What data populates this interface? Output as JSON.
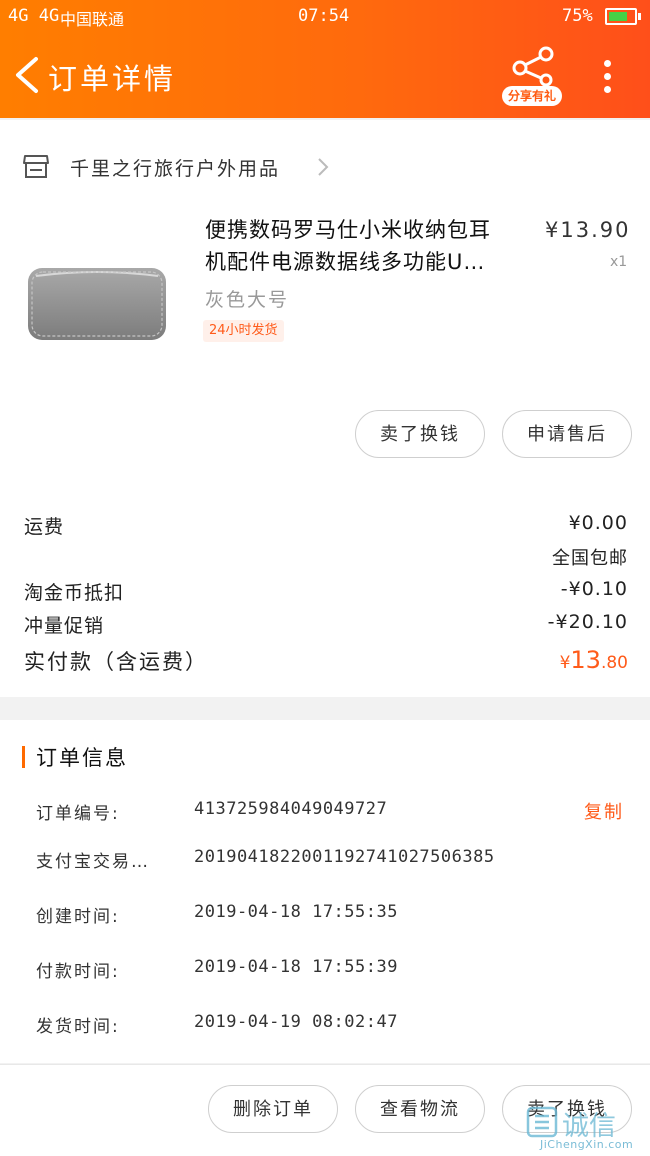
{
  "status_bar": {
    "signal": "4G 4G",
    "carrier": "中国联通",
    "time": "07:54",
    "battery": "75%"
  },
  "header": {
    "title": "订单详情",
    "share_badge": "分享有礼",
    "icons": [
      "chevron-left-icon",
      "share-icon",
      "more-vertical-icon"
    ]
  },
  "shop": {
    "name": "千里之行旅行户外用品",
    "icon": "store-icon"
  },
  "product": {
    "title_line1": "便携数码罗马仕小米收纳包耳",
    "title_line2": "机配件电源数据线多功能U…",
    "price": "¥13.90",
    "quantity": "x1",
    "variant": "灰色大号",
    "tag": "24小时发货"
  },
  "item_actions": {
    "sell_exchange": "卖了换钱",
    "after_sale": "申请售后"
  },
  "fees": {
    "shipping_label": "运费",
    "shipping_value": "¥0.00",
    "shipping_note": "全国包邮",
    "coin_label": "淘金币抵扣",
    "coin_value": "-¥0.10",
    "promo_label": "冲量促销",
    "promo_value": "-¥20.10",
    "total_label": "实付款（含运费）",
    "total_prefix": "¥",
    "total_int": "13",
    "total_dec": ".80"
  },
  "order_info": {
    "section_title": "订单信息",
    "copy_label": "复制",
    "rows": [
      {
        "label": "订单编号:",
        "value": "413725984049049727"
      },
      {
        "label": "支付宝交易…",
        "value": "2019041822001192741027506385"
      },
      {
        "label": "创建时间:",
        "value": "2019-04-18 17:55:35"
      },
      {
        "label": "付款时间:",
        "value": "2019-04-18 17:55:39"
      },
      {
        "label": "发货时间:",
        "value": "2019-04-19 08:02:47"
      }
    ]
  },
  "bottom_actions": {
    "delete": "删除订单",
    "logistics": "查看物流",
    "sell_exchange": "卖了换钱"
  },
  "watermark": {
    "cn": "诚信",
    "en": "JiChengXin.com"
  },
  "colors": {
    "accent": "#ff6a0d",
    "price_orange": "#ff5b1a"
  }
}
